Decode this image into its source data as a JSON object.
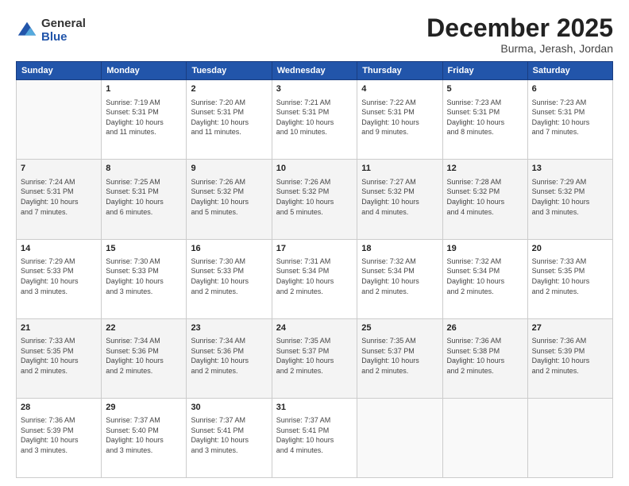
{
  "logo": {
    "general": "General",
    "blue": "Blue"
  },
  "header": {
    "month": "December 2025",
    "location": "Burma, Jerash, Jordan"
  },
  "weekdays": [
    "Sunday",
    "Monday",
    "Tuesday",
    "Wednesday",
    "Thursday",
    "Friday",
    "Saturday"
  ],
  "weeks": [
    [
      {
        "day": "",
        "info": ""
      },
      {
        "day": "1",
        "info": "Sunrise: 7:19 AM\nSunset: 5:31 PM\nDaylight: 10 hours\nand 11 minutes."
      },
      {
        "day": "2",
        "info": "Sunrise: 7:20 AM\nSunset: 5:31 PM\nDaylight: 10 hours\nand 11 minutes."
      },
      {
        "day": "3",
        "info": "Sunrise: 7:21 AM\nSunset: 5:31 PM\nDaylight: 10 hours\nand 10 minutes."
      },
      {
        "day": "4",
        "info": "Sunrise: 7:22 AM\nSunset: 5:31 PM\nDaylight: 10 hours\nand 9 minutes."
      },
      {
        "day": "5",
        "info": "Sunrise: 7:23 AM\nSunset: 5:31 PM\nDaylight: 10 hours\nand 8 minutes."
      },
      {
        "day": "6",
        "info": "Sunrise: 7:23 AM\nSunset: 5:31 PM\nDaylight: 10 hours\nand 7 minutes."
      }
    ],
    [
      {
        "day": "7",
        "info": "Sunrise: 7:24 AM\nSunset: 5:31 PM\nDaylight: 10 hours\nand 7 minutes."
      },
      {
        "day": "8",
        "info": "Sunrise: 7:25 AM\nSunset: 5:31 PM\nDaylight: 10 hours\nand 6 minutes."
      },
      {
        "day": "9",
        "info": "Sunrise: 7:26 AM\nSunset: 5:32 PM\nDaylight: 10 hours\nand 5 minutes."
      },
      {
        "day": "10",
        "info": "Sunrise: 7:26 AM\nSunset: 5:32 PM\nDaylight: 10 hours\nand 5 minutes."
      },
      {
        "day": "11",
        "info": "Sunrise: 7:27 AM\nSunset: 5:32 PM\nDaylight: 10 hours\nand 4 minutes."
      },
      {
        "day": "12",
        "info": "Sunrise: 7:28 AM\nSunset: 5:32 PM\nDaylight: 10 hours\nand 4 minutes."
      },
      {
        "day": "13",
        "info": "Sunrise: 7:29 AM\nSunset: 5:32 PM\nDaylight: 10 hours\nand 3 minutes."
      }
    ],
    [
      {
        "day": "14",
        "info": "Sunrise: 7:29 AM\nSunset: 5:33 PM\nDaylight: 10 hours\nand 3 minutes."
      },
      {
        "day": "15",
        "info": "Sunrise: 7:30 AM\nSunset: 5:33 PM\nDaylight: 10 hours\nand 3 minutes."
      },
      {
        "day": "16",
        "info": "Sunrise: 7:30 AM\nSunset: 5:33 PM\nDaylight: 10 hours\nand 2 minutes."
      },
      {
        "day": "17",
        "info": "Sunrise: 7:31 AM\nSunset: 5:34 PM\nDaylight: 10 hours\nand 2 minutes."
      },
      {
        "day": "18",
        "info": "Sunrise: 7:32 AM\nSunset: 5:34 PM\nDaylight: 10 hours\nand 2 minutes."
      },
      {
        "day": "19",
        "info": "Sunrise: 7:32 AM\nSunset: 5:34 PM\nDaylight: 10 hours\nand 2 minutes."
      },
      {
        "day": "20",
        "info": "Sunrise: 7:33 AM\nSunset: 5:35 PM\nDaylight: 10 hours\nand 2 minutes."
      }
    ],
    [
      {
        "day": "21",
        "info": "Sunrise: 7:33 AM\nSunset: 5:35 PM\nDaylight: 10 hours\nand 2 minutes."
      },
      {
        "day": "22",
        "info": "Sunrise: 7:34 AM\nSunset: 5:36 PM\nDaylight: 10 hours\nand 2 minutes."
      },
      {
        "day": "23",
        "info": "Sunrise: 7:34 AM\nSunset: 5:36 PM\nDaylight: 10 hours\nand 2 minutes."
      },
      {
        "day": "24",
        "info": "Sunrise: 7:35 AM\nSunset: 5:37 PM\nDaylight: 10 hours\nand 2 minutes."
      },
      {
        "day": "25",
        "info": "Sunrise: 7:35 AM\nSunset: 5:37 PM\nDaylight: 10 hours\nand 2 minutes."
      },
      {
        "day": "26",
        "info": "Sunrise: 7:36 AM\nSunset: 5:38 PM\nDaylight: 10 hours\nand 2 minutes."
      },
      {
        "day": "27",
        "info": "Sunrise: 7:36 AM\nSunset: 5:39 PM\nDaylight: 10 hours\nand 2 minutes."
      }
    ],
    [
      {
        "day": "28",
        "info": "Sunrise: 7:36 AM\nSunset: 5:39 PM\nDaylight: 10 hours\nand 3 minutes."
      },
      {
        "day": "29",
        "info": "Sunrise: 7:37 AM\nSunset: 5:40 PM\nDaylight: 10 hours\nand 3 minutes."
      },
      {
        "day": "30",
        "info": "Sunrise: 7:37 AM\nSunset: 5:41 PM\nDaylight: 10 hours\nand 3 minutes."
      },
      {
        "day": "31",
        "info": "Sunrise: 7:37 AM\nSunset: 5:41 PM\nDaylight: 10 hours\nand 4 minutes."
      },
      {
        "day": "",
        "info": ""
      },
      {
        "day": "",
        "info": ""
      },
      {
        "day": "",
        "info": ""
      }
    ]
  ]
}
